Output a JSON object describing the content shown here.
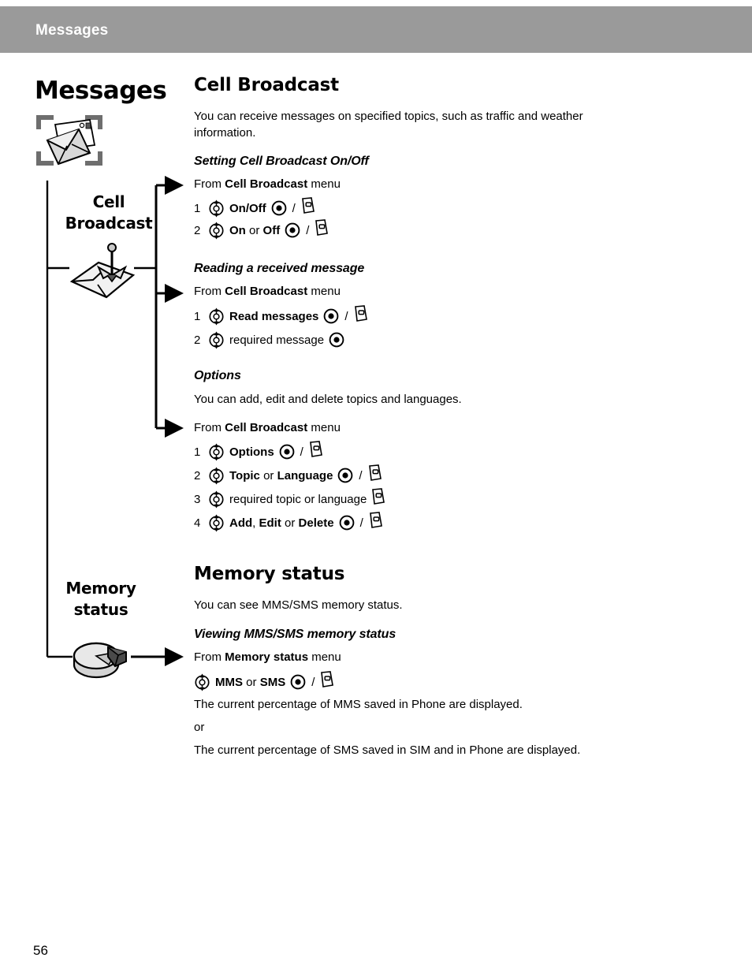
{
  "header": {
    "title": "Messages"
  },
  "rail": {
    "chapter_title": "Messages",
    "items": [
      {
        "label": "Cell\nBroadcast",
        "icon": "broadcast-envelope-icon"
      },
      {
        "label": "Memory\nstatus",
        "icon": "pie-chart-icon"
      }
    ],
    "chapter_icon": "envelope-in-brackets-icon"
  },
  "icons": {
    "nav_key": "navigation-key-icon",
    "select_key": "select-key-icon",
    "soft_key": "soft-key-icon",
    "arrow": "arrow-right-icon"
  },
  "sections": [
    {
      "title": "Cell Broadcast",
      "intro": "You can receive messages on specified topics, such as traffic and weather information.",
      "subsections": [
        {
          "title": "Setting Cell Broadcast On/Off",
          "from_prefix": "From ",
          "from_menu": "Cell Broadcast",
          "from_suffix": " menu",
          "steps": [
            {
              "num": "1",
              "parts": [
                {
                  "t": "On/Off",
                  "b": true
                }
              ],
              "select": true,
              "soft": true
            },
            {
              "num": "2",
              "parts": [
                {
                  "t": "On",
                  "b": true
                },
                {
                  "t": " or ",
                  "b": false
                },
                {
                  "t": "Off",
                  "b": true
                }
              ],
              "select": true,
              "soft": true
            }
          ]
        },
        {
          "title": "Reading a received message",
          "from_prefix": "From ",
          "from_menu": "Cell Broadcast",
          "from_suffix": " menu",
          "steps": [
            {
              "num": "1",
              "parts": [
                {
                  "t": "Read messages",
                  "b": true
                }
              ],
              "select": true,
              "soft": true
            },
            {
              "num": "2",
              "parts": [
                {
                  "t": "required message",
                  "b": false
                }
              ],
              "select": true,
              "soft": false
            }
          ]
        },
        {
          "title": "Options",
          "note": "You can add, edit and delete topics and languages.",
          "from_prefix": "From ",
          "from_menu": "Cell Broadcast",
          "from_suffix": " menu",
          "steps": [
            {
              "num": "1",
              "parts": [
                {
                  "t": "Options",
                  "b": true
                }
              ],
              "select": true,
              "soft": true
            },
            {
              "num": "2",
              "parts": [
                {
                  "t": "Topic",
                  "b": true
                },
                {
                  "t": " or ",
                  "b": false
                },
                {
                  "t": "Language",
                  "b": true
                }
              ],
              "select": true,
              "soft": true
            },
            {
              "num": "3",
              "parts": [
                {
                  "t": "required topic or language",
                  "b": false
                }
              ],
              "select": false,
              "soft": true
            },
            {
              "num": "4",
              "parts": [
                {
                  "t": "Add",
                  "b": true
                },
                {
                  "t": ", ",
                  "b": false
                },
                {
                  "t": "Edit",
                  "b": true
                },
                {
                  "t": " or ",
                  "b": false
                },
                {
                  "t": "Delete",
                  "b": true
                }
              ],
              "select": true,
              "soft": true
            }
          ]
        }
      ]
    },
    {
      "title": "Memory status",
      "intro": "You can see MMS/SMS memory status.",
      "subsections": [
        {
          "title": "Viewing MMS/SMS memory status",
          "from_prefix": "From ",
          "from_menu": "Memory status",
          "from_suffix": " menu",
          "steps": [
            {
              "num": "",
              "parts": [
                {
                  "t": "MMS",
                  "b": true
                },
                {
                  "t": " or ",
                  "b": false
                },
                {
                  "t": "SMS",
                  "b": true
                }
              ],
              "select": true,
              "soft": true
            }
          ],
          "after": [
            "The current percentage of MMS saved in Phone are displayed.",
            "or",
            "The current percentage of SMS saved in SIM and in Phone are displayed."
          ]
        }
      ]
    }
  ],
  "footer": {
    "page_number": "56"
  },
  "colors": {
    "header_band": "#9a9a9a",
    "header_text": "#ffffff",
    "body_text": "#000000",
    "bracket_gray": "#6e6e6e"
  }
}
